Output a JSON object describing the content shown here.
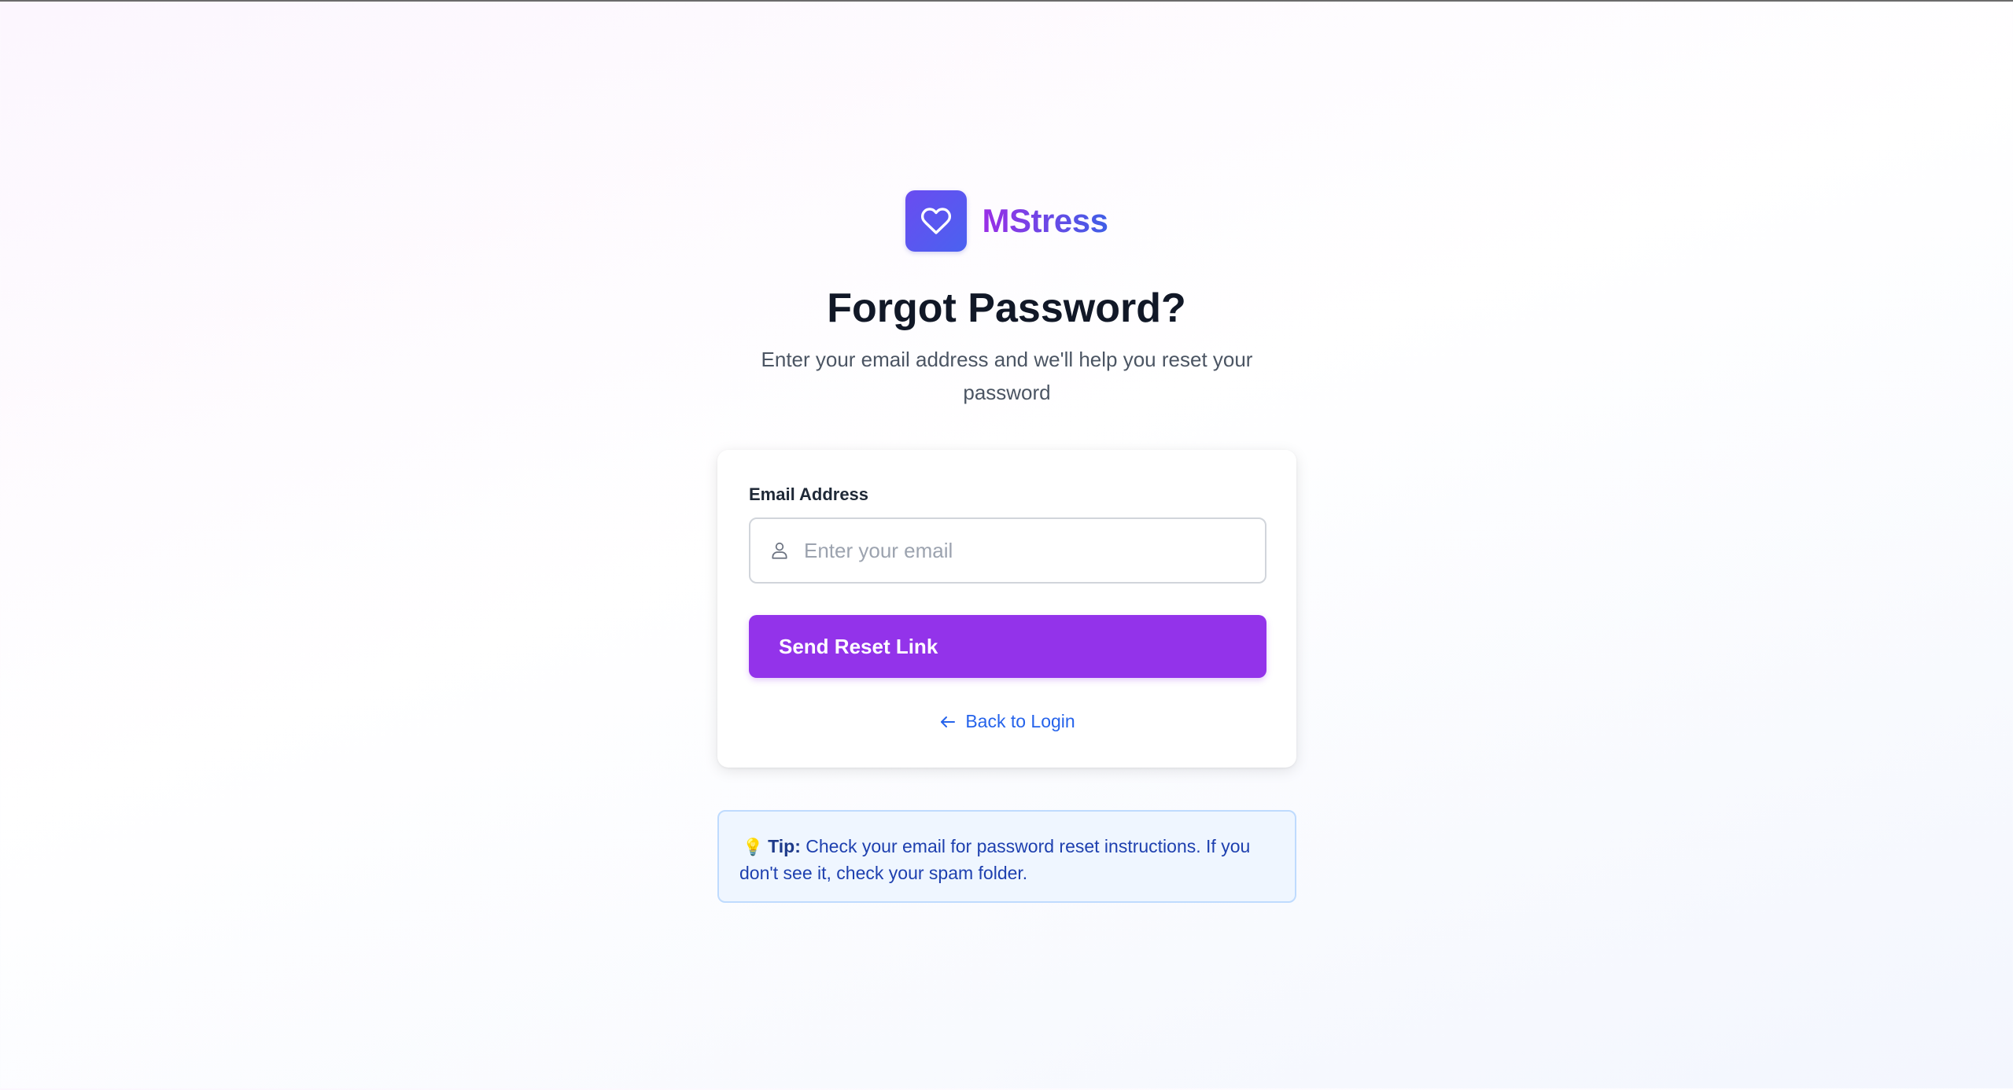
{
  "brand": {
    "name": "MStress",
    "logo_icon": "heart-icon",
    "gradient_start": "#9a2fe6",
    "gradient_end": "#3f5fe6"
  },
  "page": {
    "title": "Forgot Password?",
    "subtitle": "Enter your email address and we'll help you reset your password"
  },
  "form": {
    "email_label": "Email Address",
    "email_placeholder": "Enter your email",
    "email_value": "",
    "email_icon": "user-icon",
    "submit_label": "Send Reset Link",
    "submit_color": "#9333ea",
    "back_label": "Back to Login",
    "back_icon": "arrow-left-icon",
    "link_color": "#2563eb"
  },
  "tip": {
    "icon": "lightbulb-icon",
    "label": "Tip:",
    "text": " Check your email for password reset instructions. If you don't see it, check your spam folder."
  }
}
